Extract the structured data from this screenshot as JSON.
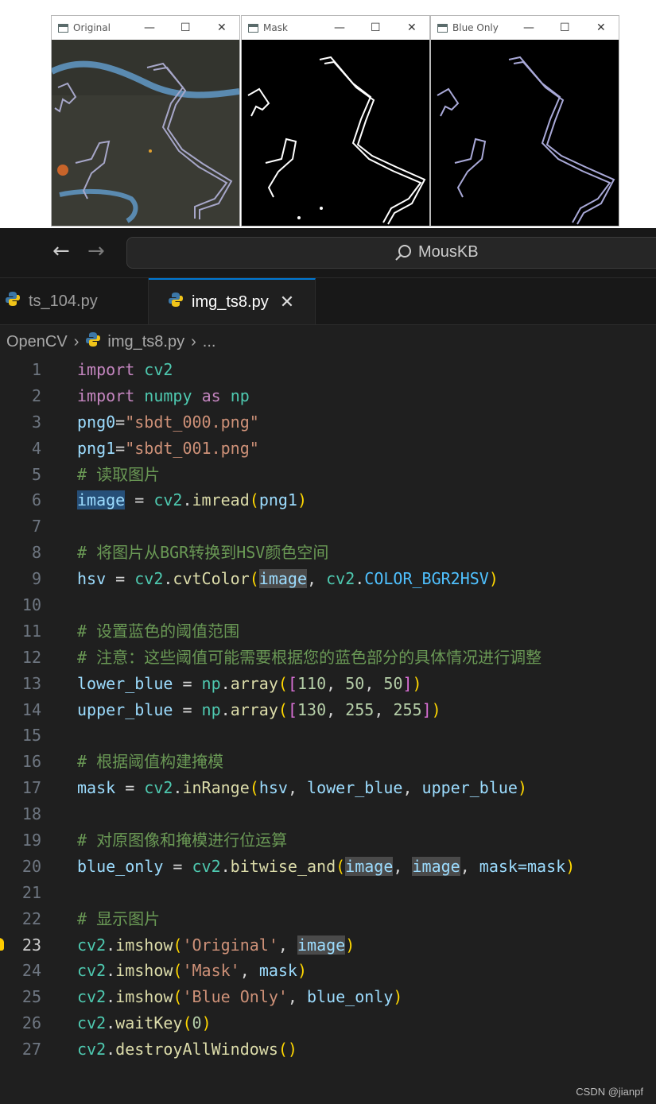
{
  "windows": [
    {
      "title": "Original"
    },
    {
      "title": "Mask"
    },
    {
      "title": "Blue Only"
    }
  ],
  "window_controls": {
    "minimize": "—",
    "maximize": "☐",
    "close": "✕"
  },
  "topbar": {
    "back": "←",
    "forward": "→",
    "search_text": "MousKB"
  },
  "tabs": [
    {
      "label": "ts_104.py",
      "active": false
    },
    {
      "label": "img_ts8.py",
      "active": true,
      "close": "✕"
    }
  ],
  "breadcrumb": {
    "folder": "OpenCV",
    "file": "img_ts8.py",
    "more": "...",
    "sep": "›"
  },
  "code": {
    "line_numbers": [
      "1",
      "2",
      "3",
      "4",
      "5",
      "6",
      "7",
      "8",
      "9",
      "10",
      "11",
      "12",
      "13",
      "14",
      "15",
      "16",
      "17",
      "18",
      "19",
      "20",
      "21",
      "22",
      "23",
      "24",
      "25",
      "26",
      "27"
    ],
    "t": {
      "import": "import",
      "cv2": "cv2",
      "numpy": "numpy",
      "as": "as",
      "np": "np",
      "png0": "png0",
      "png1": "png1",
      "eq": "=",
      "s_png0": "\"sbdt_000.png\"",
      "s_png1": "\"sbdt_001.png\"",
      "c5": "# 读取图片",
      "image": "image",
      "eqsp": " = ",
      "imread": "imread",
      "dot": ".",
      "c8": "# 将图片从BGR转换到HSV颜色空间",
      "hsv": "hsv",
      "cvtColor": "cvtColor",
      "const_bgr2hsv": "COLOR_BGR2HSV",
      "c11": "# 设置蓝色的阈值范围",
      "c12": "# 注意：这些阈值可能需要根据您的蓝色部分的具体情况进行调整",
      "lower_blue": "lower_blue",
      "upper_blue": "upper_blue",
      "array": "array",
      "n110": "110",
      "n50": "50",
      "n130": "130",
      "n255": "255",
      "comma": ", ",
      "c16": "# 根据阈值构建掩模",
      "mask": "mask",
      "inRange": "inRange",
      "c19": "# 对原图像和掩模进行位运算",
      "blue_only": "blue_only",
      "bitwise_and": "bitwise_and",
      "mask_kw": "mask=",
      "c22": "# 显示图片",
      "imshow": "imshow",
      "s_orig": "'Original'",
      "s_mask": "'Mask'",
      "s_blue": "'Blue Only'",
      "waitKey": "waitKey",
      "n0": "0",
      "destroyAllWindows": "destroyAllWindows",
      "lp": "(",
      "rp": ")",
      "lb": "[",
      "rb": "]",
      "sp": " "
    }
  },
  "watermark": "CSDN @jianpf"
}
